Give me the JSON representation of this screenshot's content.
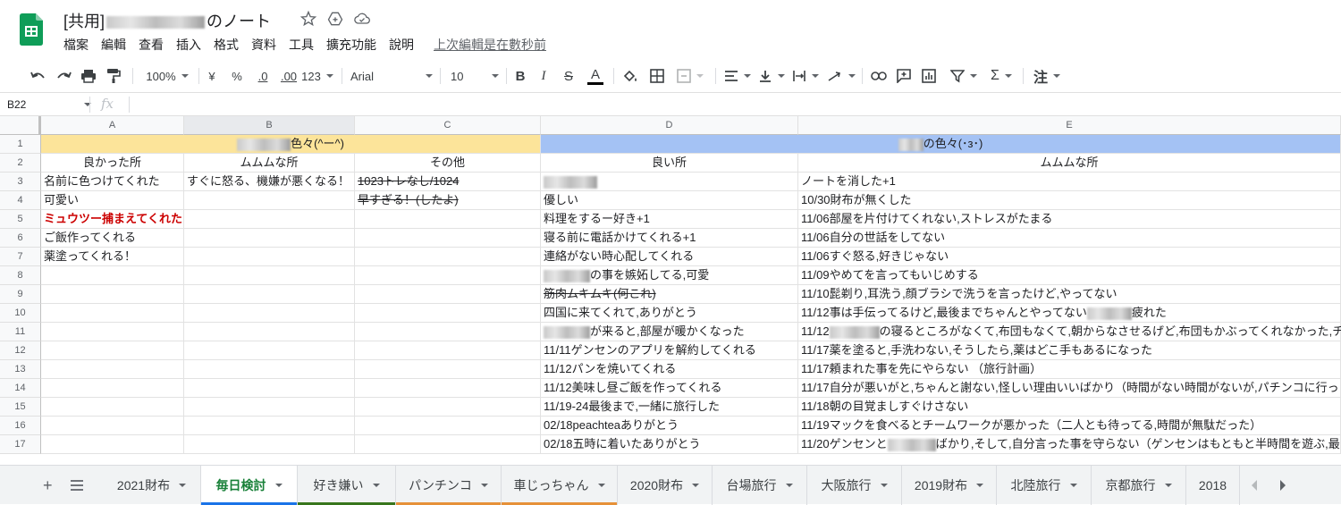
{
  "app": {
    "title_prefix": "[共用]",
    "title_suffix": "のノート",
    "menu": [
      "檔案",
      "編輯",
      "查看",
      "插入",
      "格式",
      "資料",
      "工具",
      "擴充功能",
      "說明"
    ],
    "last_edit": "上次編輯是在數秒前"
  },
  "toolbar": {
    "zoom": "100%",
    "currency": "¥",
    "percent": "%",
    "decimal_less": ".0",
    "decimal_more": ".00",
    "number_format": "123",
    "font": "Arial",
    "font_size": "10",
    "bold": "B",
    "italic": "I",
    "strike": "S",
    "text_color": "A",
    "sum": "Σ",
    "lang": "注"
  },
  "formula_bar": {
    "cell_ref": "B22",
    "fx": "fx"
  },
  "columns": [
    {
      "label": "A"
    },
    {
      "label": "B"
    },
    {
      "label": "C"
    },
    {
      "label": "D"
    },
    {
      "label": "E"
    }
  ],
  "rows": [
    "1",
    "2",
    "3",
    "4",
    "5",
    "6",
    "7",
    "8",
    "9",
    "10",
    "11",
    "12",
    "13",
    "14",
    "15",
    "16",
    "17"
  ],
  "cells": {
    "r1": {
      "ab": "色々(^ー^)",
      "de": "の色々(･з･)"
    },
    "r2": {
      "a": "良かった所",
      "b": "ムムムな所",
      "c": "その他",
      "d": "良い所",
      "e": "ムムムな所"
    },
    "a": [
      "名前に色つけてくれた",
      "可愛い",
      "ミュウツー捕まえてくれた",
      "ご飯作ってくれる",
      "薬塗ってくれる！"
    ],
    "b": [
      "すぐに怒る、機嫌が悪くなる！"
    ],
    "c": [
      "1023トレなし/1024",
      "早すぎる！(したよ)"
    ],
    "d": [
      "",
      "優しい",
      "料理をするー好き+1",
      "寝る前に電話かけてくれる+1",
      "連絡がない時心配してくれる",
      "の事を嫉妬してる,可愛",
      "筋肉ムキムキ(何これ)",
      "四国に来てくれて,ありがとう",
      "が来ると,部屋が暖かくなった",
      "11/11ゲンセンのアプリを解約してくれる",
      "11/12パンを焼いてくれる",
      "11/12美味し昼ご飯を作ってくれる",
      "11/19-24最後まで,一緒に旅行した",
      "02/18peachteaありがとう",
      "02/18五時に着いたありがとう"
    ],
    "e": [
      "ノートを消した+1",
      "10/30財布が無くした",
      "11/06部屋を片付けてくれない,ストレスがたまる",
      "11/06自分の世話をしてない",
      "11/06すぐ怒る,好きじゃない",
      "11/09やめてを言ってもいじめする",
      "11/10髭剃り,耳洗う,顔ブラシで洗うを言ったけど,やってない",
      "11/12事は手伝ってるけど,最後までちゃんとやってない",
      "11/12",
      "11/17薬を塗ると,手洗わない,そうしたら,薬はどこ手もあるになった",
      "11/17頼まれた事を先にやらない （旅行計画）",
      "11/17自分が悪いがと,ちゃんと謝ない,怪しい理由いいばかり（時間がない時間がないが,パチンコに行っ",
      "11/18朝の目覚ましすぐけさない",
      "11/19マックを食べるとチームワークが悪かった（二人とも待ってる,時間が無駄だった）",
      "11/20ゲンセンと"
    ],
    "e_extra": {
      "e10_tail": "疲れた",
      "e11_tail": "の寝るところがなくて,布団もなくて,朝からなさせるげど,布団もかぶってくれなかった,チ",
      "e17_tail": "ばかり,そして,自分言った事を守らない（ゲンセンはもともと半時間を遊ぶ,最"
    }
  },
  "tabs": [
    {
      "label": "2021財布",
      "color": ""
    },
    {
      "label": "毎日検討",
      "color": "#1a73e8"
    },
    {
      "label": "好き嫌い",
      "color": "#38761d"
    },
    {
      "label": "パンチンコ",
      "color": "#e69138"
    },
    {
      "label": "車じっちゃん",
      "color": "#e69138"
    },
    {
      "label": "2020財布",
      "color": ""
    },
    {
      "label": "台場旅行",
      "color": ""
    },
    {
      "label": "大阪旅行",
      "color": ""
    },
    {
      "label": "2019財布",
      "color": ""
    },
    {
      "label": "北陸旅行",
      "color": ""
    },
    {
      "label": "京都旅行",
      "color": ""
    },
    {
      "label": "2018",
      "color": ""
    }
  ]
}
